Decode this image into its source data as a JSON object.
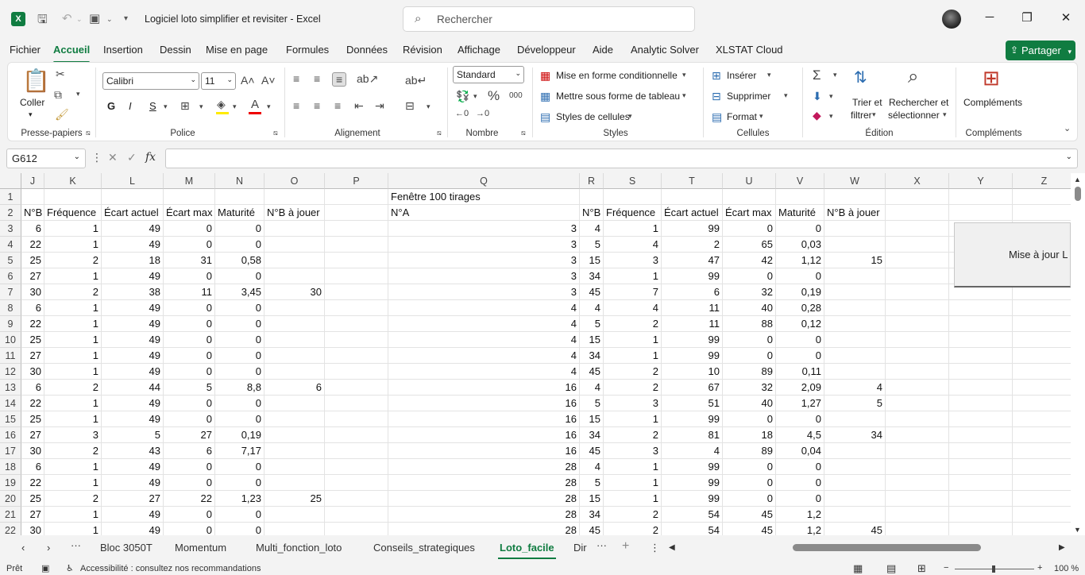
{
  "title": {
    "doc": "Logiciel loto simplifier et revisiter  -  Excel",
    "search_placeholder": "Rechercher"
  },
  "menu": [
    "Fichier",
    "Accueil",
    "Insertion",
    "Dessin",
    "Mise en page",
    "Formules",
    "Données",
    "Révision",
    "Affichage",
    "Développeur",
    "Aide",
    "Analytic Solver",
    "XLSTAT Cloud"
  ],
  "share_label": "Partager",
  "ribbon": {
    "clipboard": {
      "paste": "Coller",
      "label": "Presse-papiers"
    },
    "font": {
      "name": "Calibri",
      "size": "11",
      "bold": "G",
      "italic": "I",
      "underline": "S",
      "label": "Police"
    },
    "alignment": {
      "label": "Alignement"
    },
    "number": {
      "format": "Standard",
      "label": "Nombre"
    },
    "styles": {
      "cond": "Mise en forme conditionnelle",
      "table": "Mettre sous forme de tableau",
      "cell": "Styles de cellules",
      "label": "Styles"
    },
    "cells": {
      "insert": "Insérer",
      "delete": "Supprimer",
      "format": "Format",
      "label": "Cellules"
    },
    "editing": {
      "sort1": "Trier et",
      "sort2": "filtrer",
      "find1": "Rechercher et",
      "find2": "sélectionner",
      "label": "Édition"
    },
    "addins": {
      "btn": "Compléments",
      "label": "Compléments"
    }
  },
  "namebox": "G612",
  "columns": [
    {
      "name": "J",
      "w": 29
    },
    {
      "name": "K",
      "w": 72
    },
    {
      "name": "L",
      "w": 78
    },
    {
      "name": "M",
      "w": 65
    },
    {
      "name": "N",
      "w": 62
    },
    {
      "name": "O",
      "w": 76
    },
    {
      "name": "P",
      "w": 80
    },
    {
      "name": "Q",
      "w": 241
    },
    {
      "name": "R",
      "w": 30
    },
    {
      "name": "S",
      "w": 73
    },
    {
      "name": "T",
      "w": 77
    },
    {
      "name": "U",
      "w": 67
    },
    {
      "name": "V",
      "w": 61
    },
    {
      "name": "W",
      "w": 77
    },
    {
      "name": "X",
      "w": 80
    },
    {
      "name": "Y",
      "w": 80
    },
    {
      "name": "Z",
      "w": 80
    }
  ],
  "rows": [
    {
      "n": "1",
      "c": [
        "",
        "",
        "",
        "",
        "",
        "",
        "",
        "Fenêtre 100 tirages",
        "",
        "",
        "",
        "",
        "",
        ""
      ]
    },
    {
      "n": "2",
      "c": [
        "N°B",
        "Fréquence",
        "Écart actuel",
        "Écart max",
        "Maturité",
        "N°B à jouer",
        "",
        "N°A",
        "N°B",
        "Fréquence",
        "Écart actuel",
        "Écart max",
        "Maturité",
        "N°B à jouer"
      ]
    },
    {
      "n": "3",
      "c": [
        "6",
        "1",
        "49",
        "0",
        "0",
        "",
        "",
        "3",
        "4",
        "1",
        "99",
        "0",
        "0",
        ""
      ]
    },
    {
      "n": "4",
      "c": [
        "22",
        "1",
        "49",
        "0",
        "0",
        "",
        "",
        "3",
        "5",
        "4",
        "2",
        "65",
        "0,03",
        ""
      ]
    },
    {
      "n": "5",
      "c": [
        "25",
        "2",
        "18",
        "31",
        "0,58",
        "",
        "",
        "3",
        "15",
        "3",
        "47",
        "42",
        "1,12",
        "15"
      ]
    },
    {
      "n": "6",
      "c": [
        "27",
        "1",
        "49",
        "0",
        "0",
        "",
        "",
        "3",
        "34",
        "1",
        "99",
        "0",
        "0",
        ""
      ]
    },
    {
      "n": "7",
      "c": [
        "30",
        "2",
        "38",
        "11",
        "3,45",
        "30",
        "",
        "3",
        "45",
        "7",
        "6",
        "32",
        "0,19",
        ""
      ]
    },
    {
      "n": "8",
      "c": [
        "6",
        "1",
        "49",
        "0",
        "0",
        "",
        "",
        "4",
        "4",
        "4",
        "11",
        "40",
        "0,28",
        ""
      ]
    },
    {
      "n": "9",
      "c": [
        "22",
        "1",
        "49",
        "0",
        "0",
        "",
        "",
        "4",
        "5",
        "2",
        "11",
        "88",
        "0,12",
        ""
      ]
    },
    {
      "n": "10",
      "c": [
        "25",
        "1",
        "49",
        "0",
        "0",
        "",
        "",
        "4",
        "15",
        "1",
        "99",
        "0",
        "0",
        ""
      ]
    },
    {
      "n": "11",
      "c": [
        "27",
        "1",
        "49",
        "0",
        "0",
        "",
        "",
        "4",
        "34",
        "1",
        "99",
        "0",
        "0",
        ""
      ]
    },
    {
      "n": "12",
      "c": [
        "30",
        "1",
        "49",
        "0",
        "0",
        "",
        "",
        "4",
        "45",
        "2",
        "10",
        "89",
        "0,11",
        ""
      ]
    },
    {
      "n": "13",
      "c": [
        "6",
        "2",
        "44",
        "5",
        "8,8",
        "6",
        "",
        "16",
        "4",
        "2",
        "67",
        "32",
        "2,09",
        "4"
      ]
    },
    {
      "n": "14",
      "c": [
        "22",
        "1",
        "49",
        "0",
        "0",
        "",
        "",
        "16",
        "5",
        "3",
        "51",
        "40",
        "1,27",
        "5"
      ]
    },
    {
      "n": "15",
      "c": [
        "25",
        "1",
        "49",
        "0",
        "0",
        "",
        "",
        "16",
        "15",
        "1",
        "99",
        "0",
        "0",
        ""
      ]
    },
    {
      "n": "16",
      "c": [
        "27",
        "3",
        "5",
        "27",
        "0,19",
        "",
        "",
        "16",
        "34",
        "2",
        "81",
        "18",
        "4,5",
        "34"
      ]
    },
    {
      "n": "17",
      "c": [
        "30",
        "2",
        "43",
        "6",
        "7,17",
        "",
        "",
        "16",
        "45",
        "3",
        "4",
        "89",
        "0,04",
        ""
      ]
    },
    {
      "n": "18",
      "c": [
        "6",
        "1",
        "49",
        "0",
        "0",
        "",
        "",
        "28",
        "4",
        "1",
        "99",
        "0",
        "0",
        ""
      ]
    },
    {
      "n": "19",
      "c": [
        "22",
        "1",
        "49",
        "0",
        "0",
        "",
        "",
        "28",
        "5",
        "1",
        "99",
        "0",
        "0",
        ""
      ]
    },
    {
      "n": "20",
      "c": [
        "25",
        "2",
        "27",
        "22",
        "1,23",
        "25",
        "",
        "28",
        "15",
        "1",
        "99",
        "0",
        "0",
        ""
      ]
    },
    {
      "n": "21",
      "c": [
        "27",
        "1",
        "49",
        "0",
        "0",
        "",
        "",
        "28",
        "34",
        "2",
        "54",
        "45",
        "1,2",
        ""
      ]
    },
    {
      "n": "22",
      "c": [
        "30",
        "1",
        "49",
        "0",
        "0",
        "",
        "",
        "28",
        "45",
        "2",
        "54",
        "45",
        "1,2",
        "45"
      ]
    }
  ],
  "macro_button": "Mise à jour L",
  "sheet_tabs": [
    "Bloc 3050T",
    "Momentum",
    "Multi_fonction_loto",
    "Conseils_strategiques",
    "Loto_facile",
    "Dir"
  ],
  "active_sheet": "Loto_facile",
  "status": {
    "ready": "Prêt",
    "accessibility": "Accessibilité : consultez nos recommandations",
    "zoom": "100 %"
  }
}
